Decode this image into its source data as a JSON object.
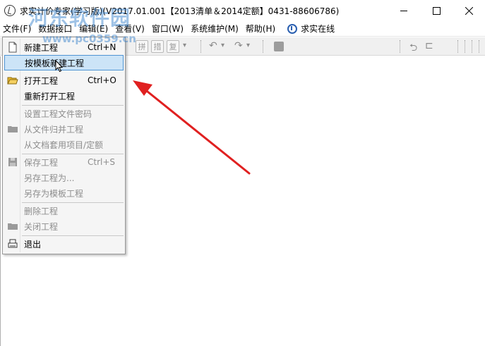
{
  "window": {
    "title": "求实计价专家(学习版)(V2017.01.001【2013清单＆2014定额】0431-88606786)"
  },
  "menubar": {
    "items": [
      "文件(F)",
      "数据接口",
      "编辑(E)",
      "查看(V)",
      "窗口(W)",
      "系统维护(M)",
      "帮助(H)"
    ],
    "online": "求实在线"
  },
  "toolbar": {
    "buttons": [
      "拼",
      "措",
      "复"
    ]
  },
  "file_menu": {
    "items": [
      {
        "label": "新建工程",
        "shortcut": "Ctrl+N",
        "disabled": false
      },
      {
        "label": "按模板新建工程",
        "shortcut": "",
        "disabled": false
      },
      {
        "label": "打开工程",
        "shortcut": "Ctrl+O",
        "disabled": false
      },
      {
        "label": "重新打开工程",
        "shortcut": "",
        "disabled": false
      },
      {
        "label": "设置工程文件密码",
        "shortcut": "",
        "disabled": true
      },
      {
        "label": "从文件归并工程",
        "shortcut": "",
        "disabled": true
      },
      {
        "label": "从文档套用项目/定额",
        "shortcut": "",
        "disabled": true
      },
      {
        "label": "保存工程",
        "shortcut": "Ctrl+S",
        "disabled": true
      },
      {
        "label": "另存工程为...",
        "shortcut": "",
        "disabled": true
      },
      {
        "label": "另存为模板工程",
        "shortcut": "",
        "disabled": true
      },
      {
        "label": "删除工程",
        "shortcut": "",
        "disabled": true
      },
      {
        "label": "关闭工程",
        "shortcut": "",
        "disabled": true
      },
      {
        "label": "退出",
        "shortcut": "",
        "disabled": false
      }
    ]
  },
  "watermark": {
    "logo": "河东软件园",
    "url": "www.pc0359.cn"
  },
  "colors": {
    "highlight_bg": "#cce4f7",
    "highlight_border": "#4f94d3",
    "annotation_arrow": "#e02020",
    "disabled_text": "#8d8d8d"
  }
}
